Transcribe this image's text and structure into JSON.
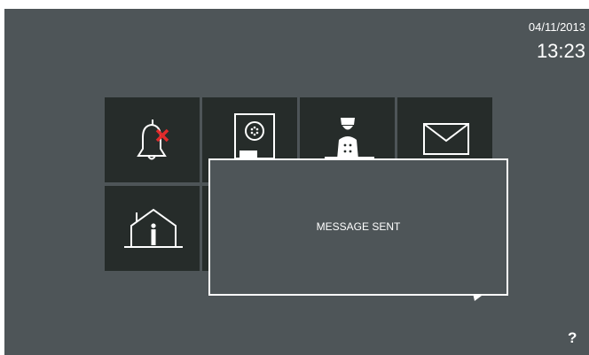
{
  "status": {
    "date": "04/11/2013",
    "time": "13:23"
  },
  "menu": {
    "tiles": [
      {
        "icon": "bell-muted-icon"
      },
      {
        "icon": "door-panel-icon"
      },
      {
        "icon": "concierge-icon"
      },
      {
        "icon": "envelope-icon"
      },
      {
        "icon": "home-icon"
      }
    ]
  },
  "popup": {
    "message": "MESSAGE SENT"
  },
  "help": {
    "label": "?"
  },
  "colors": {
    "background": "#4e5558",
    "tile": "#262c2a",
    "accent_red": "#e02b2b",
    "foreground": "#ffffff"
  }
}
